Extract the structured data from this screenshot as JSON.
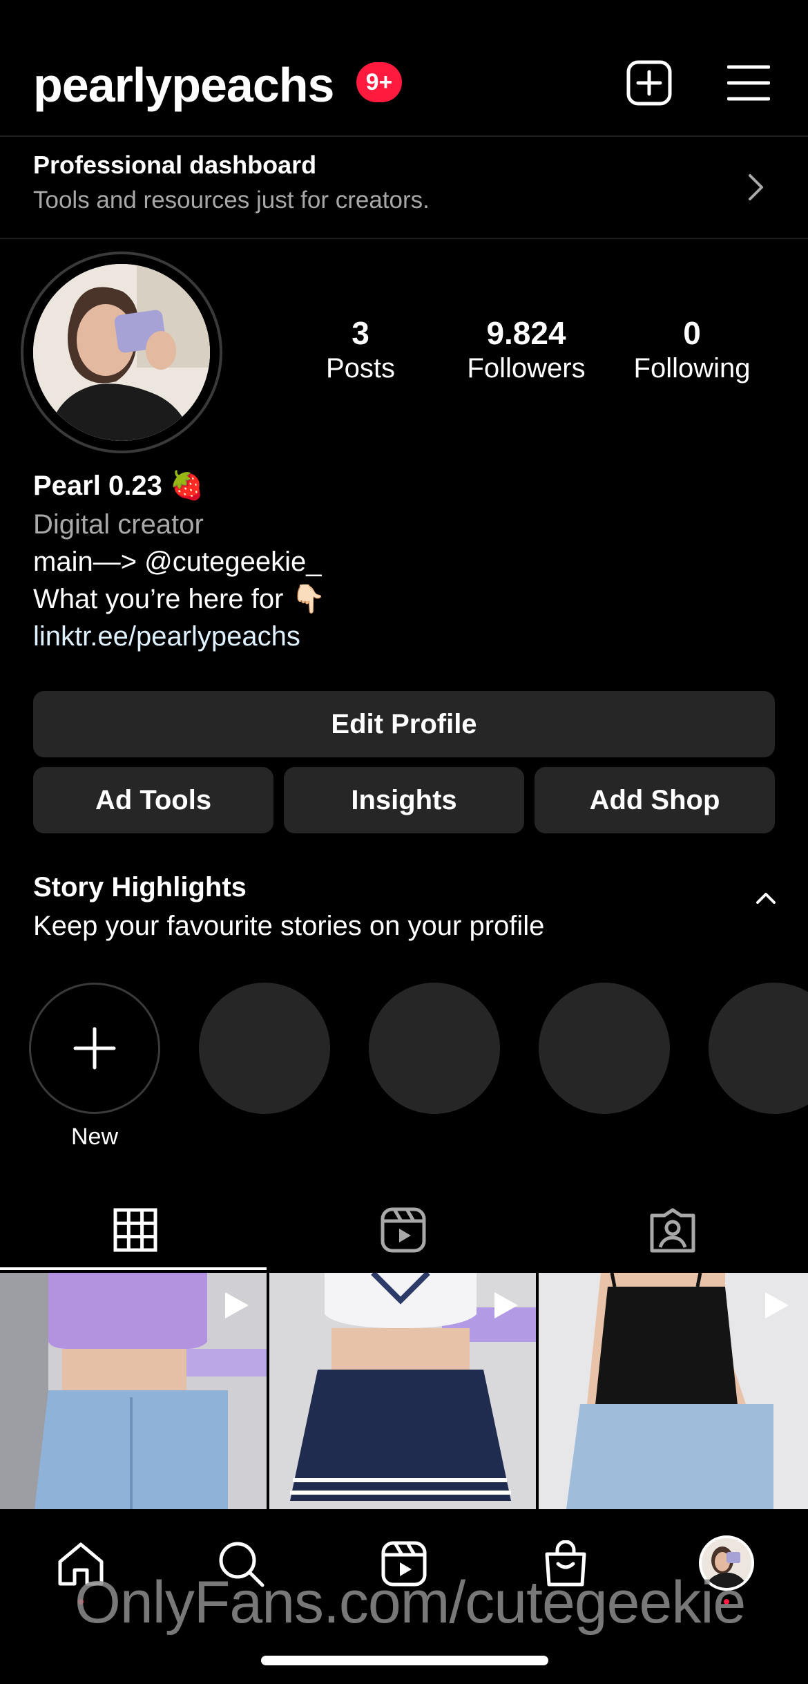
{
  "header": {
    "username": "pearlypeachs",
    "notification_badge": "9+"
  },
  "dashboard": {
    "title": "Professional dashboard",
    "subtitle": "Tools and resources just for creators."
  },
  "stats": [
    {
      "value": "3",
      "label": "Posts"
    },
    {
      "value": "9.824",
      "label": "Followers"
    },
    {
      "value": "0",
      "label": "Following"
    }
  ],
  "bio": {
    "name": "Pearl 0.23 🍓",
    "category": "Digital creator",
    "line1": "main—> @cutegeekie_",
    "line2": "What you’re here for 👇🏻",
    "link": "linktr.ee/pearlypeachs"
  },
  "buttons": {
    "edit_profile": "Edit Profile",
    "ad_tools": "Ad Tools",
    "insights": "Insights",
    "add_shop": "Add Shop"
  },
  "highlights": {
    "title": "Story Highlights",
    "subtitle": "Keep your favourite stories on your profile",
    "new_label": "New"
  },
  "watermark": "OnlyFans.com/cutegeekie",
  "colors": {
    "accent": "#ff1a3e",
    "link": "#e0f1ff",
    "surface": "#262626",
    "muted": "#a8a8a8"
  },
  "icons": [
    "new-post-icon",
    "menu-icon",
    "chevron-right-icon",
    "chevron-up-icon",
    "plus-icon",
    "grid-icon",
    "reels-icon",
    "tagged-icon",
    "play-icon",
    "home-icon",
    "search-icon",
    "reels-nav-icon",
    "shop-icon",
    "profile-avatar-icon"
  ]
}
